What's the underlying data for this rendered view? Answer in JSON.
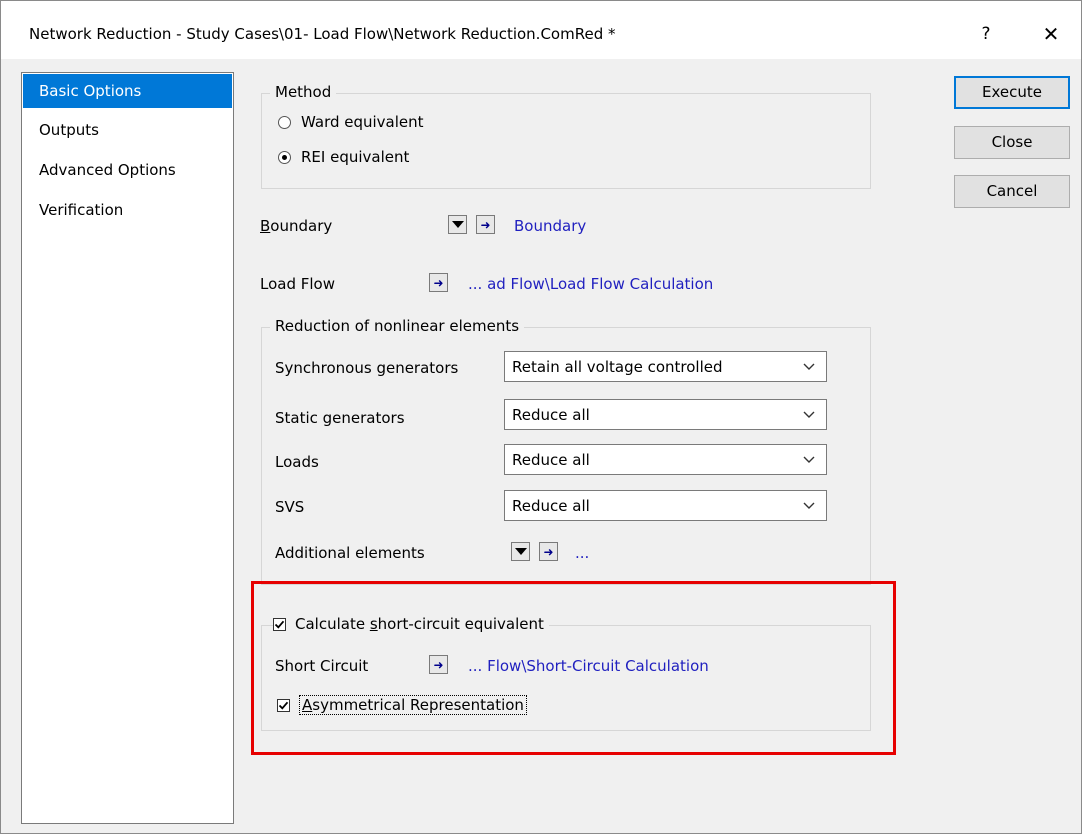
{
  "window": {
    "title": "Network Reduction - Study Cases\\01- Load Flow\\Network Reduction.ComRed *",
    "help_label": "?",
    "close_label": "✕"
  },
  "sidebar": {
    "items": [
      {
        "label": "Basic Options",
        "active": true
      },
      {
        "label": "Outputs",
        "active": false
      },
      {
        "label": "Advanced Options",
        "active": false
      },
      {
        "label": "Verification",
        "active": false
      }
    ]
  },
  "method": {
    "title": "Method",
    "options": [
      {
        "label": "Ward equivalent",
        "selected": false
      },
      {
        "label": "REI equivalent",
        "selected": true
      }
    ]
  },
  "boundary": {
    "label_first": "B",
    "label_rest": "oundary",
    "link": "Boundary"
  },
  "load_flow": {
    "label": "Load Flow",
    "link": "... ad Flow\\Load Flow Calculation"
  },
  "nonlinear": {
    "title": "Reduction of nonlinear elements",
    "rows": [
      {
        "label": "Synchronous generators",
        "value": "Retain all voltage controlled"
      },
      {
        "label": "Static generators",
        "value": "Reduce all"
      },
      {
        "label": "Loads",
        "value": "Reduce all"
      },
      {
        "label": "SVS",
        "value": "Reduce all"
      }
    ],
    "additional_label": "Additional elements",
    "additional_link": "..."
  },
  "short_circuit": {
    "calc_label_pre": "Calculate ",
    "calc_label_u": "s",
    "calc_label_post": "hort-circuit equivalent",
    "calc_checked": true,
    "sc_label": "Short Circuit",
    "sc_link": "... Flow\\Short-Circuit Calculation",
    "asym_label_u": "A",
    "asym_label_rest": "symmetrical Representation",
    "asym_checked": true
  },
  "buttons": {
    "execute": "Execute",
    "close": "Close",
    "cancel": "Cancel"
  },
  "colors": {
    "accent": "#0078d7",
    "link": "#1f1fbf",
    "highlight": "#e60000",
    "arrow": "#00008b"
  }
}
